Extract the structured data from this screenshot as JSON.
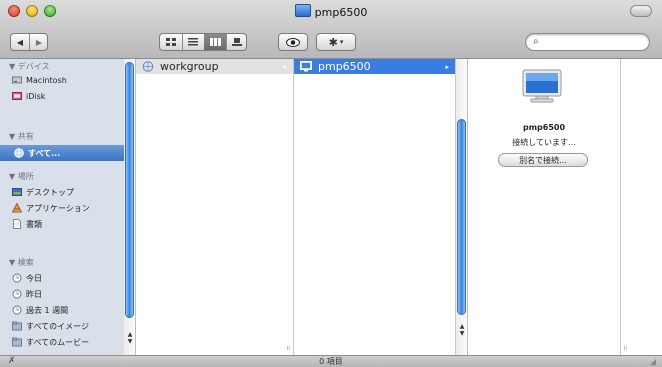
{
  "window": {
    "title": "pmp6500"
  },
  "toolbar": {
    "back": "◀",
    "forward": "▶",
    "views": [
      "icon-view",
      "list-view",
      "column-view",
      "coverflow-view"
    ],
    "active_view": 2,
    "quicklook_icon": "eye-icon",
    "action_icon": "gear-icon",
    "search_placeholder": ""
  },
  "sidebar": {
    "devices_header": "▼ デバイス",
    "devices": [
      "Macintosh",
      "iDisk"
    ],
    "shared_header": "▼ 共有",
    "shared": [
      "すべて..."
    ],
    "places_header": "▼ 場所",
    "places": [
      "デスクトップ",
      "アプリケーション",
      "書類"
    ],
    "search_header": "▼ 検索",
    "searches": [
      "今日",
      "昨日",
      "過去 1 週間",
      "すべてのイメージ",
      "すべてのムービー"
    ]
  },
  "columns": {
    "col1": [
      "workgroup"
    ],
    "col2": [
      "pmp6500"
    ]
  },
  "preview": {
    "name": "pmp6500",
    "status": "接続しています...",
    "connect_as": "別名で接続..."
  },
  "status": {
    "items": "0 項目"
  },
  "colors": {
    "selection": "#3a7de0",
    "sidebar_bg": "#d9e0ea"
  }
}
